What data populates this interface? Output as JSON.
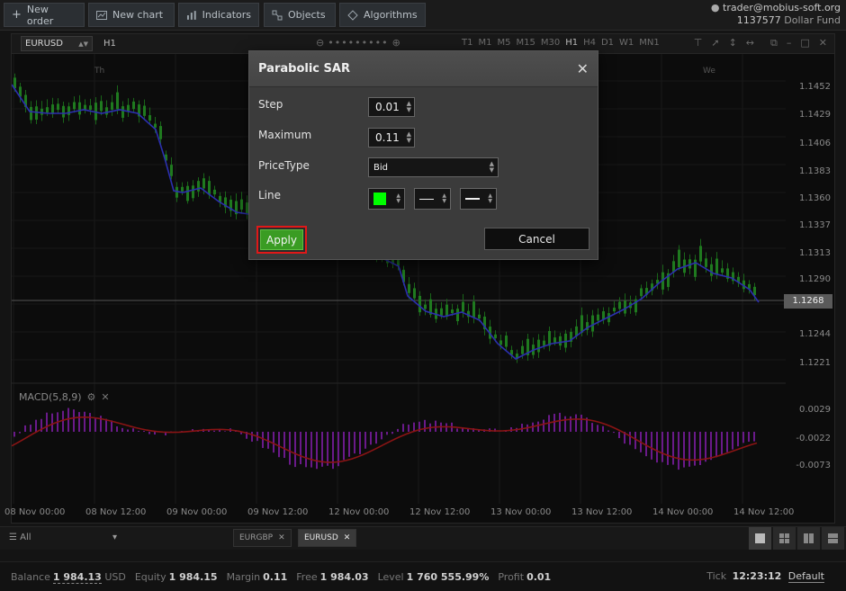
{
  "toolbar": {
    "new_order": "New order",
    "new_chart": "New chart",
    "indicators": "Indicators",
    "objects": "Objects",
    "algorithms": "Algorithms"
  },
  "account": {
    "user": "trader@mobius-soft.org",
    "id": "1137577",
    "fund": "Dollar Fund"
  },
  "chart": {
    "symbol": "EURUSD",
    "timeframe": "H1",
    "timeframes": [
      "T1",
      "M1",
      "M5",
      "M15",
      "M30",
      "H1",
      "H4",
      "D1",
      "W1",
      "MN1"
    ],
    "day_labels": [
      "Th",
      "We"
    ],
    "price_labels": [
      "1.1452",
      "1.1429",
      "1.1406",
      "1.1383",
      "1.1360",
      "1.1337",
      "1.1313",
      "1.1290",
      "1.1244",
      "1.1221"
    ],
    "current_price": "1.1268",
    "macd_title": "MACD(5,8,9)",
    "macd_labels": [
      "0.0029",
      "-0.0022",
      "-0.0073"
    ],
    "time_labels": [
      "08 Nov 00:00",
      "08 Nov 12:00",
      "09 Nov 00:00",
      "09 Nov 12:00",
      "12 Nov 00:00",
      "12 Nov 12:00",
      "13 Nov 00:00",
      "13 Nov 12:00",
      "14 Nov 00:00",
      "14 Nov 12:00"
    ]
  },
  "dialog": {
    "title": "Parabolic SAR",
    "close_icon": "close-icon",
    "step_label": "Step",
    "step_value": "0.01",
    "maximum_label": "Maximum",
    "maximum_value": "0.11",
    "pricetype_label": "PriceType",
    "pricetype_value": "Bid",
    "line_label": "Line",
    "line_color": "#00ff00",
    "apply_label": "Apply",
    "cancel_label": "Cancel"
  },
  "tabs": {
    "filter": "All",
    "items": [
      "EURGBP",
      "EURUSD"
    ],
    "active": "EURUSD"
  },
  "status": {
    "balance_label": "Balance",
    "balance_value": "1 984.13",
    "balance_currency": "USD",
    "equity_label": "Equity",
    "equity_value": "1 984.15",
    "margin_label": "Margin",
    "margin_value": "0.11",
    "free_label": "Free",
    "free_value": "1 984.03",
    "level_label": "Level",
    "level_value": "1 760 555.99%",
    "profit_label": "Profit",
    "profit_value": "0.01",
    "tick_label": "Tick",
    "tick_value": "12:23:12",
    "tick_mode": "Default"
  },
  "colors": {
    "accent_green": "#3a9c23",
    "highlight_red": "#e01818",
    "candle_green": "#1f7a1f",
    "sar_blue": "#2b2fae",
    "macd_bar": "#6a1a8a",
    "macd_signal": "#8a1414"
  }
}
